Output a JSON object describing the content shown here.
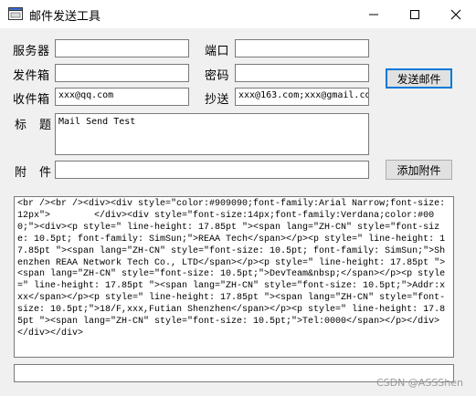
{
  "window": {
    "title": "邮件发送工具"
  },
  "form": {
    "server_label": "服务器",
    "server_value": "",
    "port_label": "端口",
    "port_value": "",
    "from_label": "发件箱",
    "from_value": "",
    "password_label": "密码",
    "password_value": "",
    "to_label": "收件箱",
    "to_value": "xxx@qq.com",
    "cc_label": "抄送",
    "cc_value": "xxx@163.com;xxx@gmail.co",
    "subject_label": "标　题",
    "subject_value": "Mail Send Test",
    "attach_label": "附　件",
    "attach_value": ""
  },
  "buttons": {
    "send": "发送邮件",
    "add_attachment": "添加附件"
  },
  "body_html": "<br /><br /><div><div style=\"color:#909090;font-family:Arial Narrow;font-size:12px\">        </div><div style=\"font-size:14px;font-family:Verdana;color:#000;\"><div><p style=\" line-height: 17.85pt \"><span lang=\"ZH-CN\" style=\"font-size: 10.5pt; font-family: SimSun;\">REAA Tech</span></p><p style=\" line-height: 17.85pt \"><span lang=\"ZH-CN\" style=\"font-size: 10.5pt; font-family: SimSun;\">Shenzhen REAA Network Tech Co., LTD</span></p><p style=\" line-height: 17.85pt \"><span lang=\"ZH-CN\" style=\"font-size: 10.5pt;\">DevTeam&nbsp;</span></p><p style=\" line-height: 17.85pt \"><span lang=\"ZH-CN\" style=\"font-size: 10.5pt;\">Addr:xxx</span></p><p style=\" line-height: 17.85pt \"><span lang=\"ZH-CN\" style=\"font-size: 10.5pt;\">18/F,xxx,Futian Shenzhen</span></p><p style=\" line-height: 17.85pt \"><span lang=\"ZH-CN\" style=\"font-size: 10.5pt;\">Tel:0000</span></p></div></div></div>",
  "status_text": "",
  "watermark": "CSDN @ASSShen"
}
